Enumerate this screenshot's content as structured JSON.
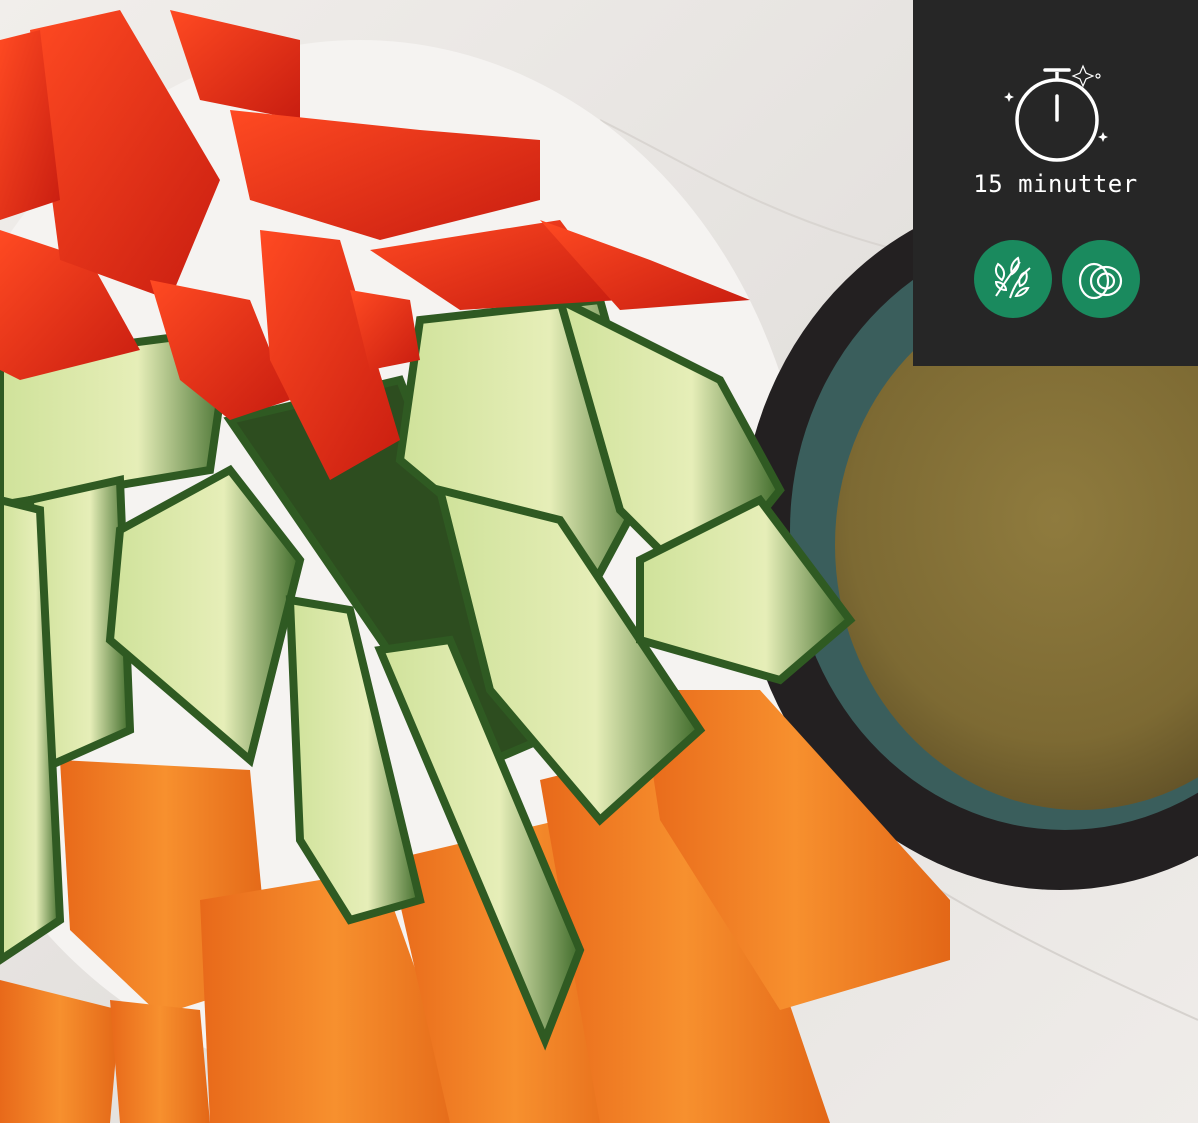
{
  "badge": {
    "icon": "stopwatch-icon",
    "time_label": "15 minutter",
    "diet_icons": [
      {
        "icon": "vegan-leaves-icon",
        "color": "#1a8a5e"
      },
      {
        "icon": "egg-icon",
        "color": "#1a8a5e"
      }
    ]
  },
  "colors": {
    "badge_background": "#262626",
    "accent_green": "#1a8a5e",
    "marble": "#ece9e6"
  }
}
